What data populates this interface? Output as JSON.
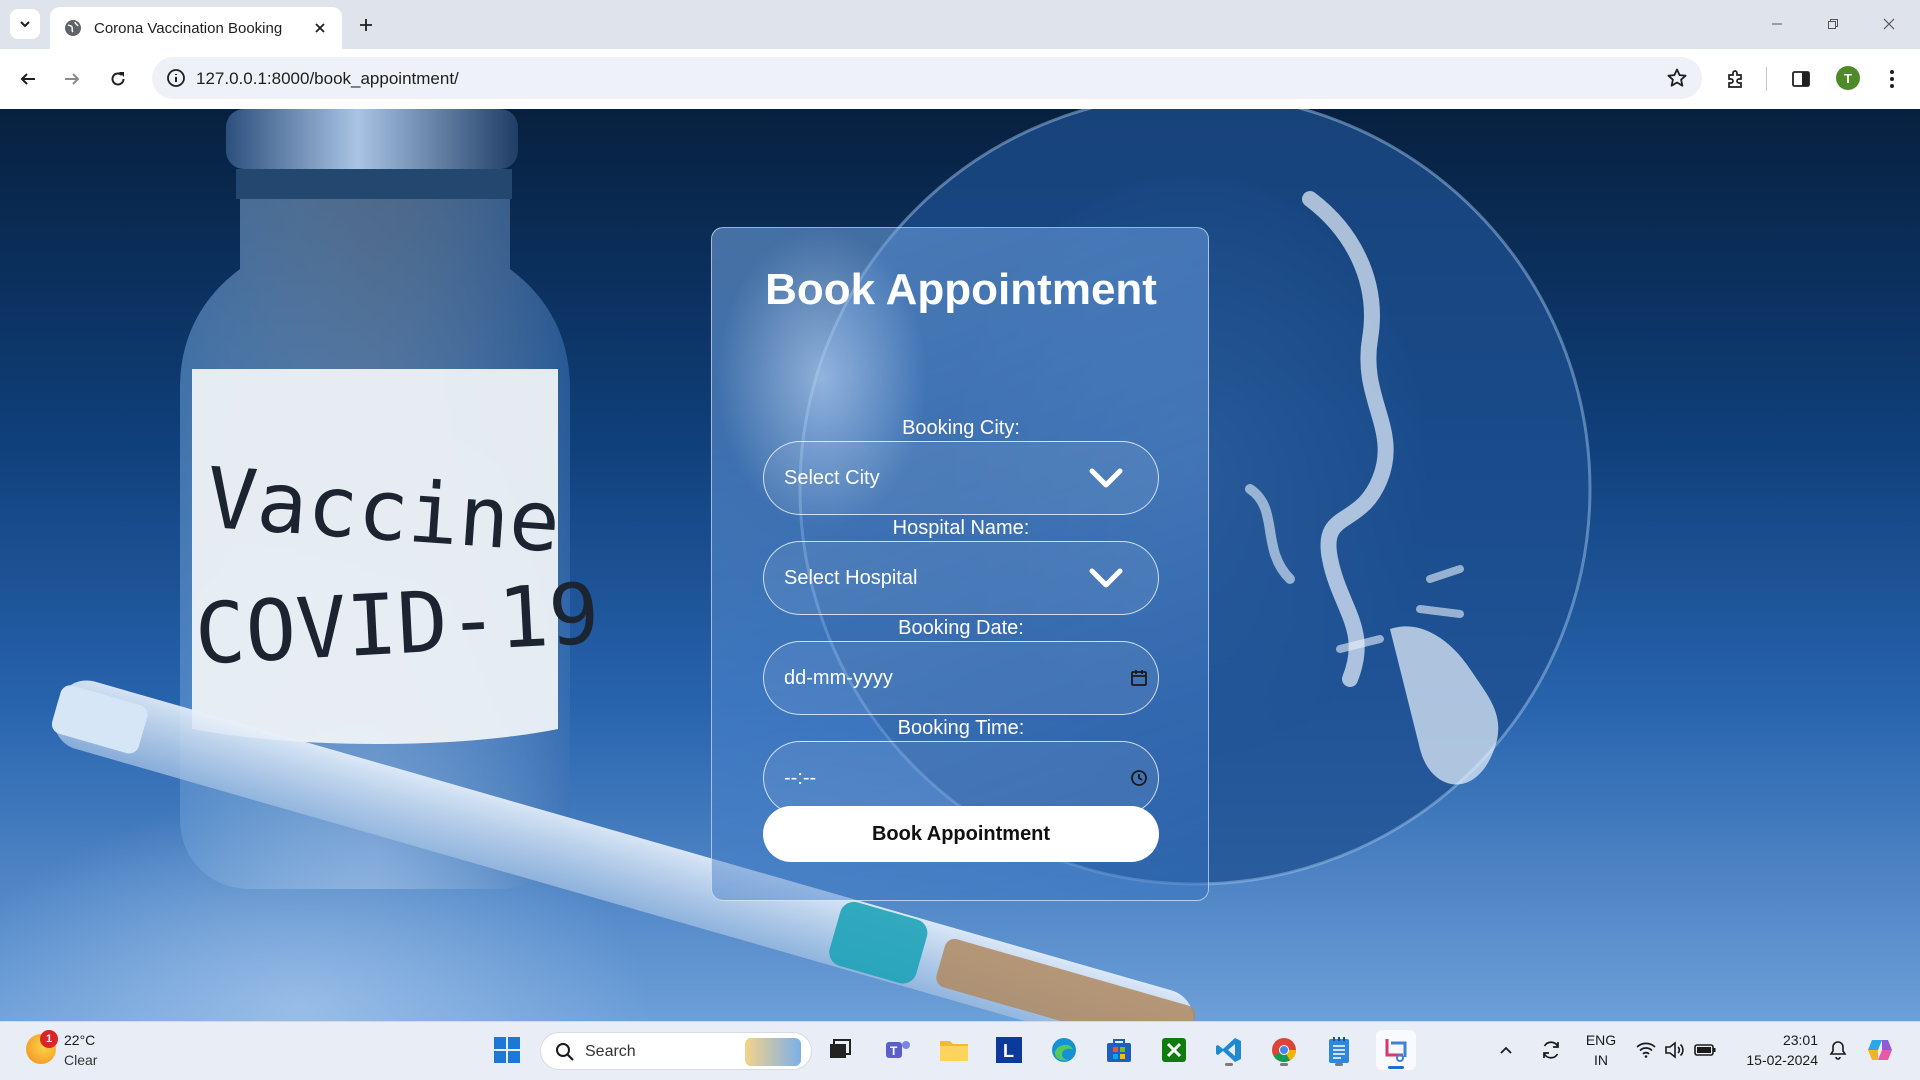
{
  "browser": {
    "tab": {
      "title": "Corona Vaccination Booking"
    },
    "url": "127.0.0.1:8000/book_appointment/",
    "profile_initial": "T"
  },
  "form": {
    "title": "Book Appointment",
    "city": {
      "label": "Booking City:",
      "value": "Select City"
    },
    "hospital": {
      "label": "Hospital Name:",
      "value": "Select Hospital"
    },
    "date": {
      "label": "Booking Date:",
      "placeholder": "dd-mm-yyyy"
    },
    "time": {
      "label": "Booking Time:",
      "placeholder": "--:--"
    },
    "submit_label": "Book Appointment"
  },
  "background": {
    "vial_text_line1": "Vaccine",
    "vial_text_line2": "COVID-19"
  },
  "taskbar": {
    "weather": {
      "temp": "22°C",
      "condition": "Clear",
      "badge": "1"
    },
    "search_label": "Search",
    "language": {
      "line1": "ENG",
      "line2": "IN"
    },
    "clock": {
      "time": "23:01",
      "date": "15-02-2024"
    },
    "pinned": [
      "start-icon",
      "file-explorer",
      "teams",
      "folder",
      "l-app",
      "edge",
      "store",
      "xbox",
      "vscode",
      "chrome",
      "notepad",
      "snipping-tool"
    ]
  },
  "colors": {
    "accent_blue": "#1b6fd1",
    "card_border": "#ffffff",
    "button_bg": "#ffffff"
  }
}
